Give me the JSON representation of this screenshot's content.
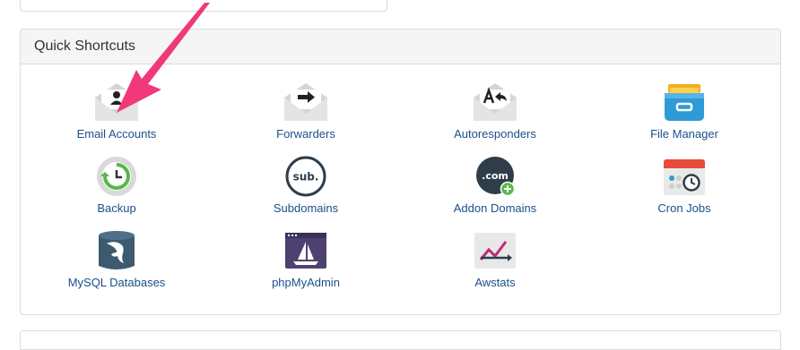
{
  "panel": {
    "title": "Quick Shortcuts"
  },
  "shortcuts": [
    {
      "label": "Email Accounts",
      "icon": "email-accounts-icon"
    },
    {
      "label": "Forwarders",
      "icon": "forwarders-icon"
    },
    {
      "label": "Autoresponders",
      "icon": "autoresponders-icon"
    },
    {
      "label": "File Manager",
      "icon": "file-manager-icon"
    },
    {
      "label": "Backup",
      "icon": "backup-icon"
    },
    {
      "label": "Subdomains",
      "icon": "subdomains-icon"
    },
    {
      "label": "Addon Domains",
      "icon": "addon-domains-icon"
    },
    {
      "label": "Cron Jobs",
      "icon": "cron-jobs-icon"
    },
    {
      "label": "MySQL Databases",
      "icon": "mysql-databases-icon"
    },
    {
      "label": "phpMyAdmin",
      "icon": "phpmyadmin-icon"
    },
    {
      "label": "Awstats",
      "icon": "awstats-icon"
    }
  ],
  "icon_text": {
    "subdomains": "sub.",
    "addon_domains": ".com"
  },
  "colors": {
    "link": "#1b4f8a",
    "arrow": "#f0387a",
    "envelope": "#dcdcdc",
    "file_manager": "#2f9bd6",
    "backup_ring": "#59b847",
    "cron_red": "#e74c3c"
  }
}
